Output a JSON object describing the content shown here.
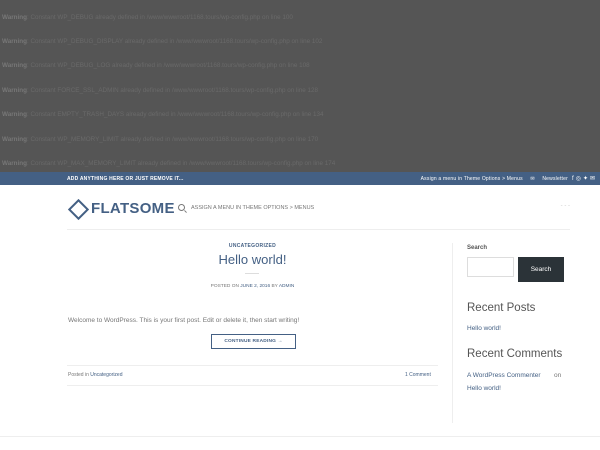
{
  "warnings": [
    {
      "label": "Warning",
      "text": ": Constant WP_DEBUG already defined in /www/wwwroot/1168.tours/wp-config.php on line 100"
    },
    {
      "label": "Warning",
      "text": ": Constant WP_DEBUG_DISPLAY already defined in /www/wwwroot/1168.tours/wp-config.php on line 102"
    },
    {
      "label": "Warning",
      "text": ": Constant WP_DEBUG_LOG already defined in /www/wwwroot/1168.tours/wp-config.php on line 108"
    },
    {
      "label": "Warning",
      "text": ": Constant FORCE_SSL_ADMIN already defined in /www/wwwroot/1168.tours/wp-config.php on line 128"
    },
    {
      "label": "Warning",
      "text": ": Constant EMPTY_TRASH_DAYS already defined in /www/wwwroot/1168.tours/wp-config.php on line 134"
    },
    {
      "label": "Warning",
      "text": ": Constant WP_MEMORY_LIMIT already defined in /www/wwwroot/1168.tours/wp-config.php on line 170"
    },
    {
      "label": "Warning",
      "text": ": Constant WP_MAX_MEMORY_LIMIT already defined in /www/wwwroot/1168.tours/wp-config.php on line 174"
    }
  ],
  "topbar": {
    "left_text": "ADD ANYTHING HERE OR JUST REMOVE IT...",
    "menu_text": "Assign a menu in Theme Options > Menus",
    "newsletter": "Newsletter",
    "social_icons": [
      "facebook-icon",
      "instagram-icon",
      "twitter-icon",
      "email-icon"
    ]
  },
  "header": {
    "logo": "FLATSOME",
    "nav_text": "ASSIGN A MENU IN THEME OPTIONS > MENUS",
    "right_text": "-  -  -"
  },
  "post": {
    "category": "UNCATEGORIZED",
    "title": "Hello world!",
    "meta_prefix": "POSTED ON ",
    "date": "JUNE 2, 2016",
    "meta_by": " BY ",
    "author": "ADMIN",
    "excerpt": "Welcome to WordPress. This is your first post. Edit or delete it, then start writing!",
    "continue": "CONTINUE READING →",
    "posted_in_label": "Posted in ",
    "posted_in_cat": "Uncategorized",
    "comment_count": "1 Comment"
  },
  "sidebar": {
    "search_title": "Search",
    "search_placeholder": "",
    "search_button": "Search",
    "recent_posts_title": "Recent Posts",
    "recent_post": "Hello world!",
    "recent_comments_title": "Recent Comments",
    "commenter": "A WordPress Commenter",
    "on": "on",
    "comment_post": "Hello world!"
  },
  "colors": {
    "primary": "#446084",
    "dark_button": "#2b3338",
    "warning_bg": "#555555"
  }
}
